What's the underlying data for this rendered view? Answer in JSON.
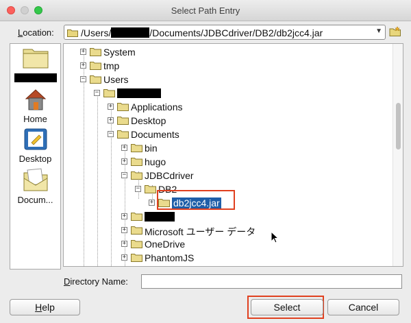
{
  "window": {
    "title": "Select Path Entry"
  },
  "location": {
    "label_prefix": "",
    "label_underlined": "L",
    "label_rest": "ocation:",
    "path_before": "/Users/",
    "path_after": "/Documents/JDBCdriver/DB2/db2jcc4.jar"
  },
  "places": [
    {
      "label": "Home",
      "icon": "home-icon"
    },
    {
      "label": "Desktop",
      "icon": "desktop-icon"
    },
    {
      "label": "Docum...",
      "icon": "documents-icon"
    }
  ],
  "tree": {
    "nodes": [
      {
        "label": "System",
        "expander": "+"
      },
      {
        "label": "tmp",
        "expander": "+"
      },
      {
        "label": "Users",
        "expander": "-"
      },
      {
        "label": "",
        "expander": "-",
        "redacted": true
      },
      {
        "label": "Applications",
        "expander": "+"
      },
      {
        "label": "Desktop",
        "expander": "+"
      },
      {
        "label": "Documents",
        "expander": "-"
      },
      {
        "label": "bin",
        "expander": "+"
      },
      {
        "label": "hugo",
        "expander": "+"
      },
      {
        "label": "JDBCdriver",
        "expander": "-"
      },
      {
        "label": "DB2",
        "expander": "-"
      },
      {
        "label": "db2jcc4.jar",
        "expander": "+",
        "selected": true
      },
      {
        "label": "",
        "expander": "+",
        "redacted": true
      },
      {
        "label": "Microsoft ユーザー データ",
        "expander": "+"
      },
      {
        "label": "OneDrive",
        "expander": "+"
      },
      {
        "label": "PhantomJS",
        "expander": "+"
      }
    ]
  },
  "directory_name": {
    "label_underlined": "D",
    "label_rest": "irectory Name:",
    "value": ""
  },
  "buttons": {
    "help_underlined": "H",
    "help_rest": "elp",
    "select": "Select",
    "cancel": "Cancel"
  },
  "colors": {
    "selection": "#1e5ea8",
    "highlight_box": "#e0401f"
  }
}
